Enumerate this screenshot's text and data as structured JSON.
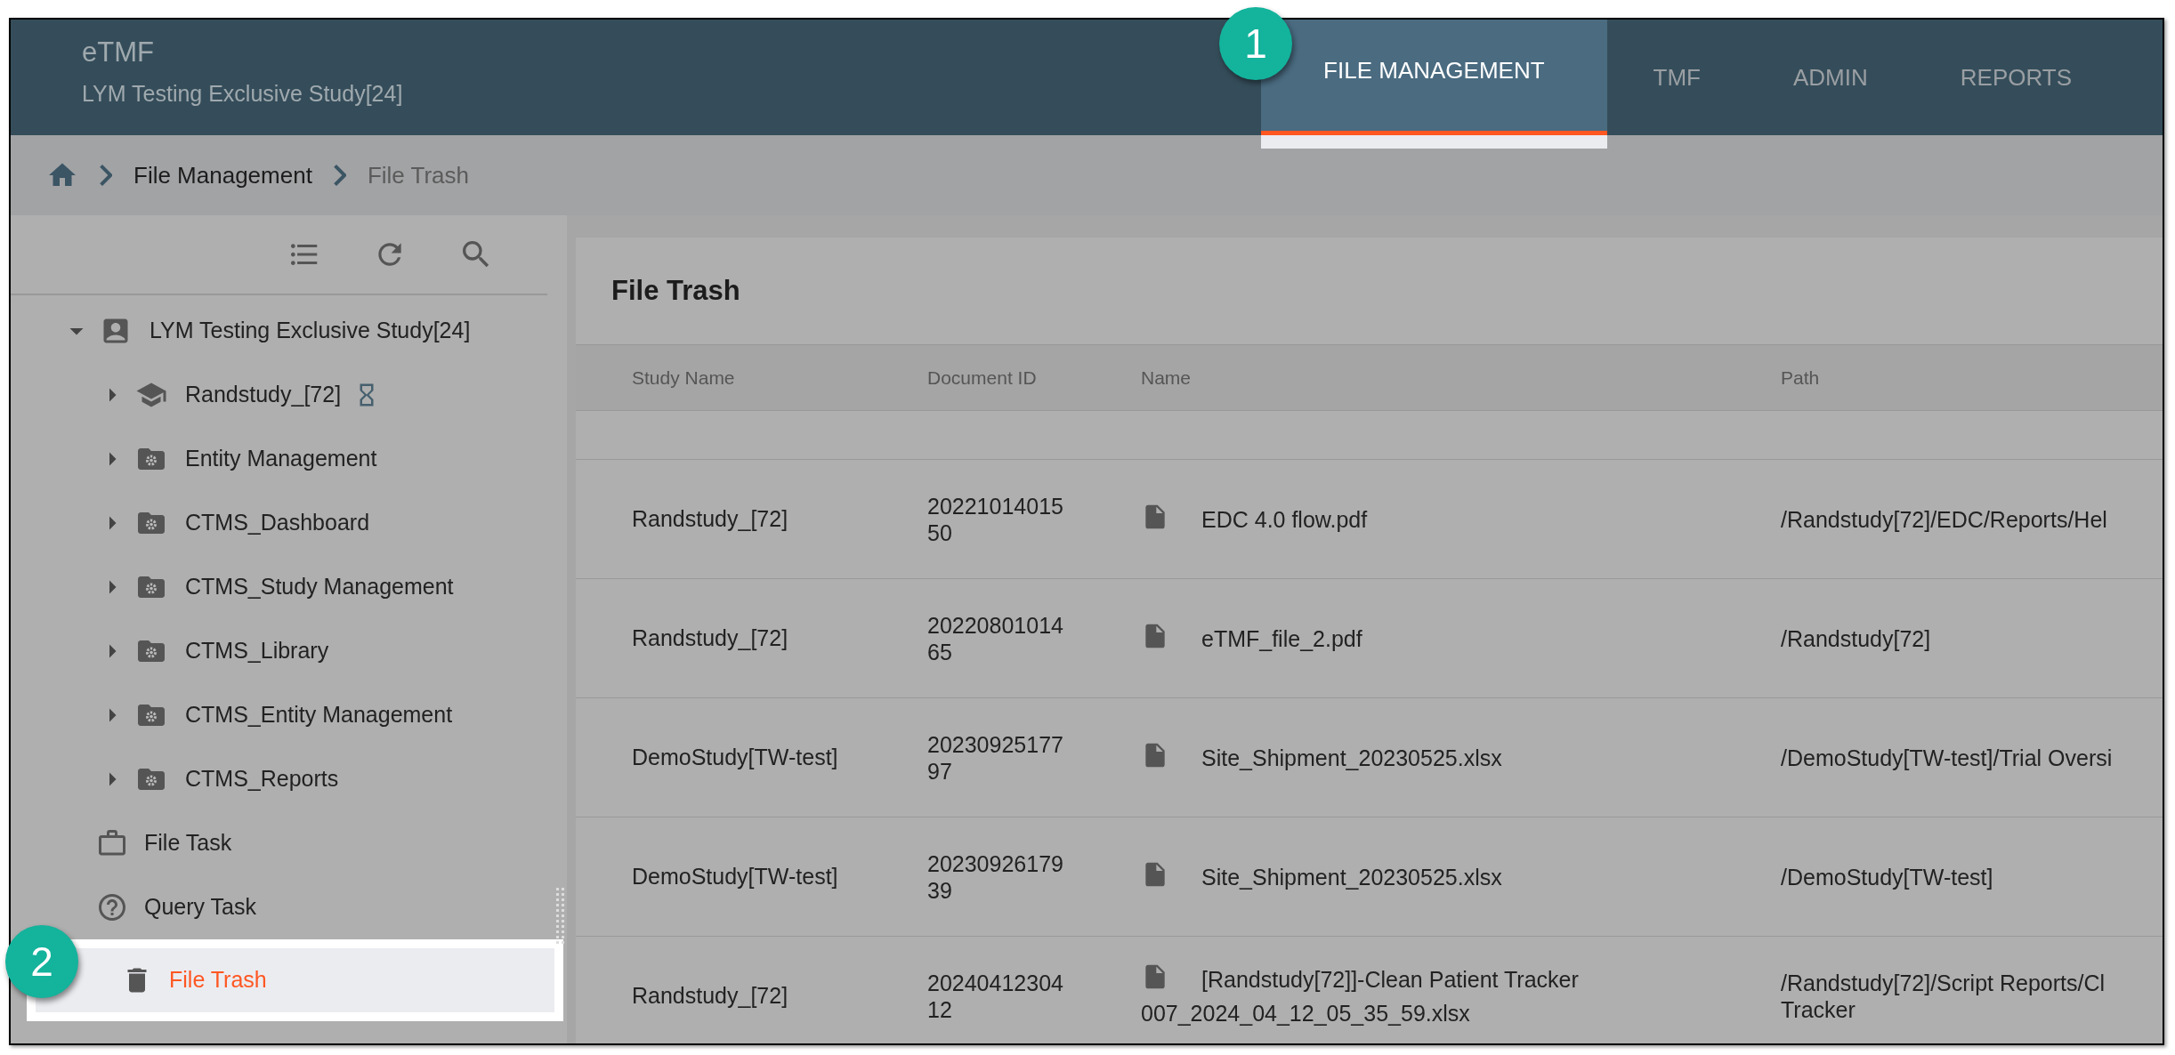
{
  "app": {
    "title": "eTMF",
    "subtitle": "LYM Testing Exclusive Study[24]"
  },
  "tabs": [
    {
      "label": "FILE MANAGEMENT",
      "selected": true
    },
    {
      "label": "TMF",
      "selected": false
    },
    {
      "label": "ADMIN",
      "selected": false
    },
    {
      "label": "REPORTS",
      "selected": false
    }
  ],
  "breadcrumb": [
    "File Management",
    "File Trash"
  ],
  "tree": [
    {
      "label": "LYM Testing Exclusive Study[24]",
      "kind": "site",
      "expanded": true,
      "pending": false,
      "children": [
        {
          "label": "Randstudy_[72]",
          "kind": "study",
          "expanded": false,
          "pending": true
        },
        {
          "label": "Entity Management",
          "kind": "module",
          "expanded": false,
          "pending": false
        },
        {
          "label": "CTMS_Dashboard",
          "kind": "module",
          "expanded": false,
          "pending": false
        },
        {
          "label": "CTMS_Study Management",
          "kind": "module",
          "expanded": false,
          "pending": false
        },
        {
          "label": "CTMS_Library",
          "kind": "module",
          "expanded": false,
          "pending": false
        },
        {
          "label": "CTMS_Entity Management",
          "kind": "module",
          "expanded": false,
          "pending": false
        },
        {
          "label": "CTMS_Reports",
          "kind": "module",
          "expanded": false,
          "pending": false
        }
      ]
    }
  ],
  "nav": [
    {
      "label": "File Task",
      "kind": "task",
      "selected": false
    },
    {
      "label": "Query Task",
      "kind": "query",
      "selected": false
    },
    {
      "label": "File Trash",
      "kind": "trash",
      "selected": true
    }
  ],
  "panel": {
    "title": "File Trash"
  },
  "table": {
    "columns": [
      "Study Name",
      "Document ID",
      "Name",
      "Path"
    ],
    "rows": [
      {
        "study": "Randstudy_[72]",
        "document_id": "2022101401550",
        "name": "EDC 4.0 flow.pdf",
        "path_lines": [
          "/Randstudy[72]/EDC/Reports/Hel"
        ]
      },
      {
        "study": "Randstudy_[72]",
        "document_id": "2022080101465",
        "name": "eTMF_file_2.pdf",
        "path_lines": [
          "/Randstudy[72]"
        ]
      },
      {
        "study": "DemoStudy[TW-test]",
        "document_id": "2023092517797",
        "name": "Site_Shipment_20230525.xlsx",
        "path_lines": [
          "/DemoStudy[TW-test]/Trial Oversi"
        ]
      },
      {
        "study": "DemoStudy[TW-test]",
        "document_id": "2023092617939",
        "name": "Site_Shipment_20230525.xlsx",
        "path_lines": [
          "/DemoStudy[TW-test]"
        ]
      },
      {
        "study": "Randstudy_[72]",
        "document_id": "2024041230412",
        "name": "[Randstudy[72]]-Clean Patient Tracker 007_2024_04_12_05_35_59.xlsx",
        "path_lines": [
          "/Randstudy[72]/Script Reports/Cl",
          "Tracker"
        ]
      }
    ]
  },
  "callouts": [
    "1",
    "2"
  ]
}
